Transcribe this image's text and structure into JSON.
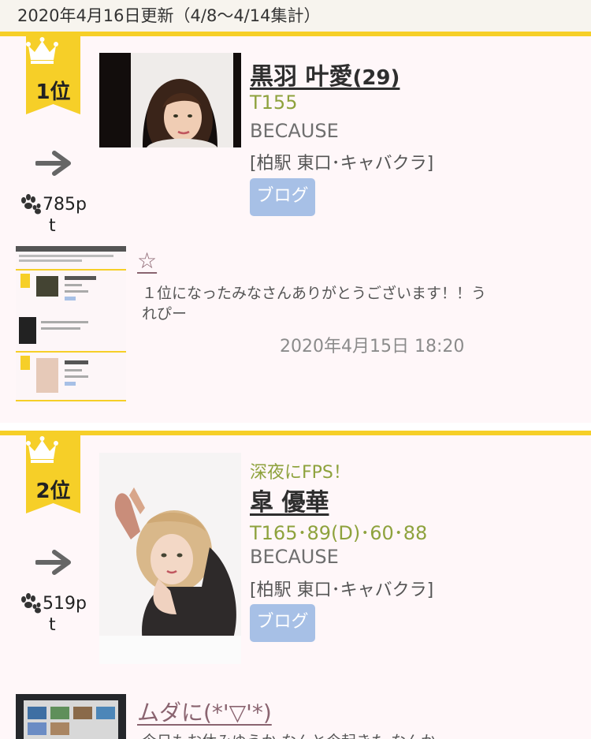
{
  "header": {
    "update_text": "2020年4月16日更新（4/8〜4/14集計）"
  },
  "colors": {
    "accent": "#f6cf28",
    "name": "#2e2e2e",
    "stats": "#8ea23d",
    "blog_button": "#a7c0e6",
    "post_title": "#8a6470"
  },
  "entries": [
    {
      "rank": "1位",
      "trend_icon": "arrow-right-icon",
      "points": "785p",
      "points_suffix": "t",
      "catchphrase": "",
      "name": "黒羽 叶愛",
      "age": "(29)",
      "stats": "T155",
      "shop": "BECAUSE",
      "location": "[柏駅 東口･キャバクラ]",
      "blog_label": "ブログ",
      "post": {
        "title": "☆",
        "body": "１位になったみなさんありがとうございます！！うれぴー",
        "date": "2020年4月15日 18:20"
      }
    },
    {
      "rank": "2位",
      "trend_icon": "arrow-right-icon",
      "points": "519p",
      "points_suffix": "t",
      "catchphrase": "深夜にFPS！",
      "name": "皐 優華",
      "age": "",
      "stats": "T165･89(D)･60･88",
      "shop": "BECAUSE",
      "location": "[柏駅 東口･キャバクラ]",
      "blog_label": "ブログ",
      "post": {
        "title": "ムダに(*'▽'*)",
        "body": "今日もお休みゆうか なんと今起きた なんか"
      }
    }
  ]
}
